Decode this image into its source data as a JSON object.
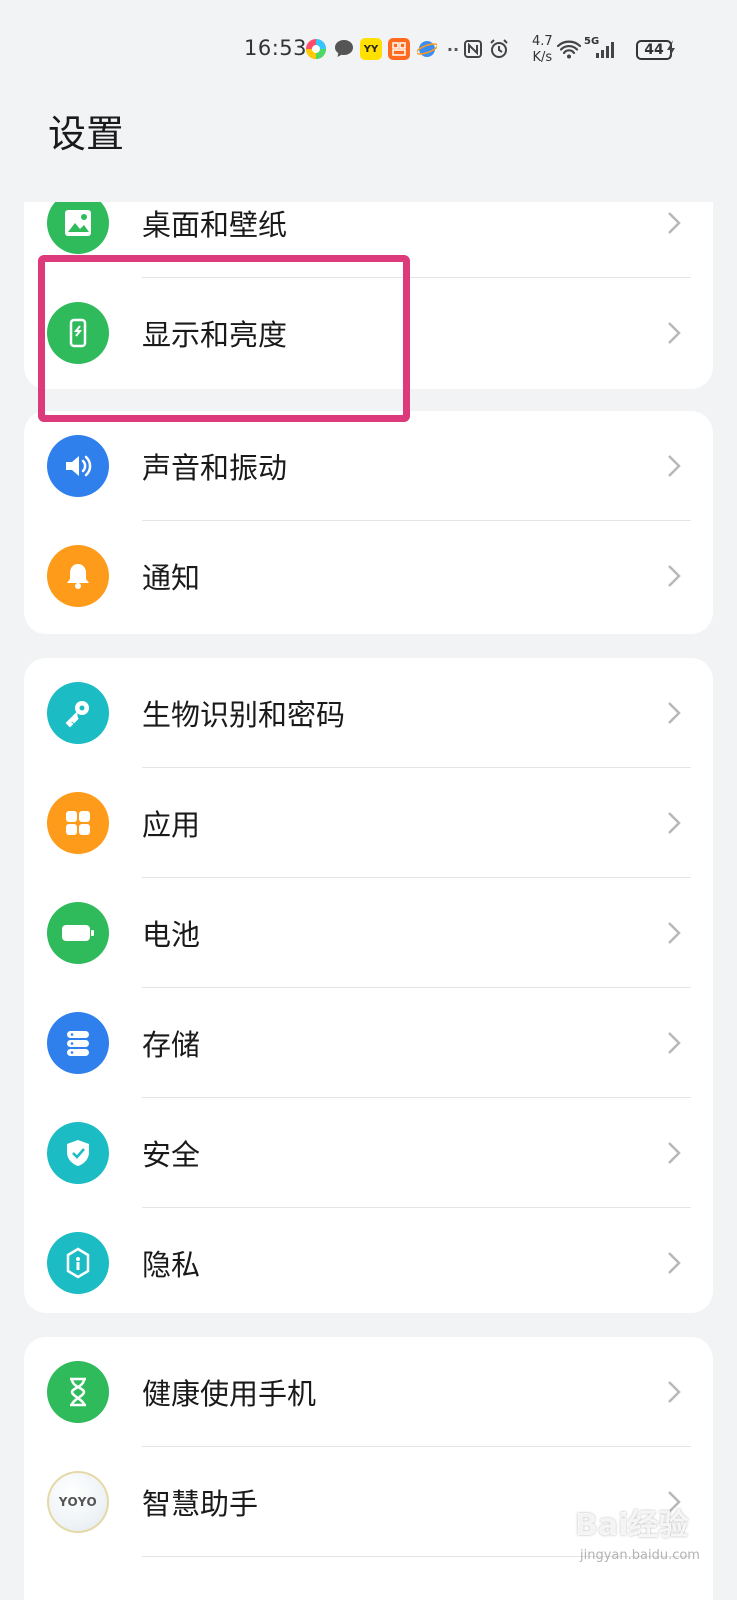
{
  "status_bar": {
    "time": "16:53",
    "net_speed_value": "4.7",
    "net_speed_unit": "K/s",
    "network": "5G",
    "battery": "44",
    "yy_badge": "YY"
  },
  "title": "设置",
  "cards": [
    {
      "items": [
        {
          "label": "桌面和壁纸",
          "icon": "wallpaper-icon",
          "color": "#2fbb5c"
        },
        {
          "label": "显示和亮度",
          "icon": "display-brightness-icon",
          "color": "#2fbb5c"
        }
      ]
    },
    {
      "items": [
        {
          "label": "声音和振动",
          "icon": "speaker-icon",
          "color": "#2f80ed"
        },
        {
          "label": "通知",
          "icon": "bell-icon",
          "color": "#ff9b1a"
        }
      ]
    },
    {
      "items": [
        {
          "label": "生物识别和密码",
          "icon": "key-icon",
          "color": "#1cbcc4"
        },
        {
          "label": "应用",
          "icon": "apps-grid-icon",
          "color": "#ff9b1a"
        },
        {
          "label": "电池",
          "icon": "battery-icon",
          "color": "#2fbb5c"
        },
        {
          "label": "存储",
          "icon": "storage-icon",
          "color": "#2f80ed"
        },
        {
          "label": "安全",
          "icon": "shield-check-icon",
          "color": "#1cbcc4"
        },
        {
          "label": "隐私",
          "icon": "privacy-lock-icon",
          "color": "#1cbcc4"
        }
      ]
    },
    {
      "items": [
        {
          "label": "健康使用手机",
          "icon": "hourglass-icon",
          "color": "#2fbb5c"
        },
        {
          "label": "智慧助手",
          "icon": "yoyo-assistant-icon",
          "color": "#e8eef2",
          "badge_text": "YOYO"
        }
      ]
    }
  ],
  "watermark": {
    "text": "Bai经验",
    "sub": "jingyan.baidu.com"
  },
  "highlight_color": "#dc3a7a"
}
